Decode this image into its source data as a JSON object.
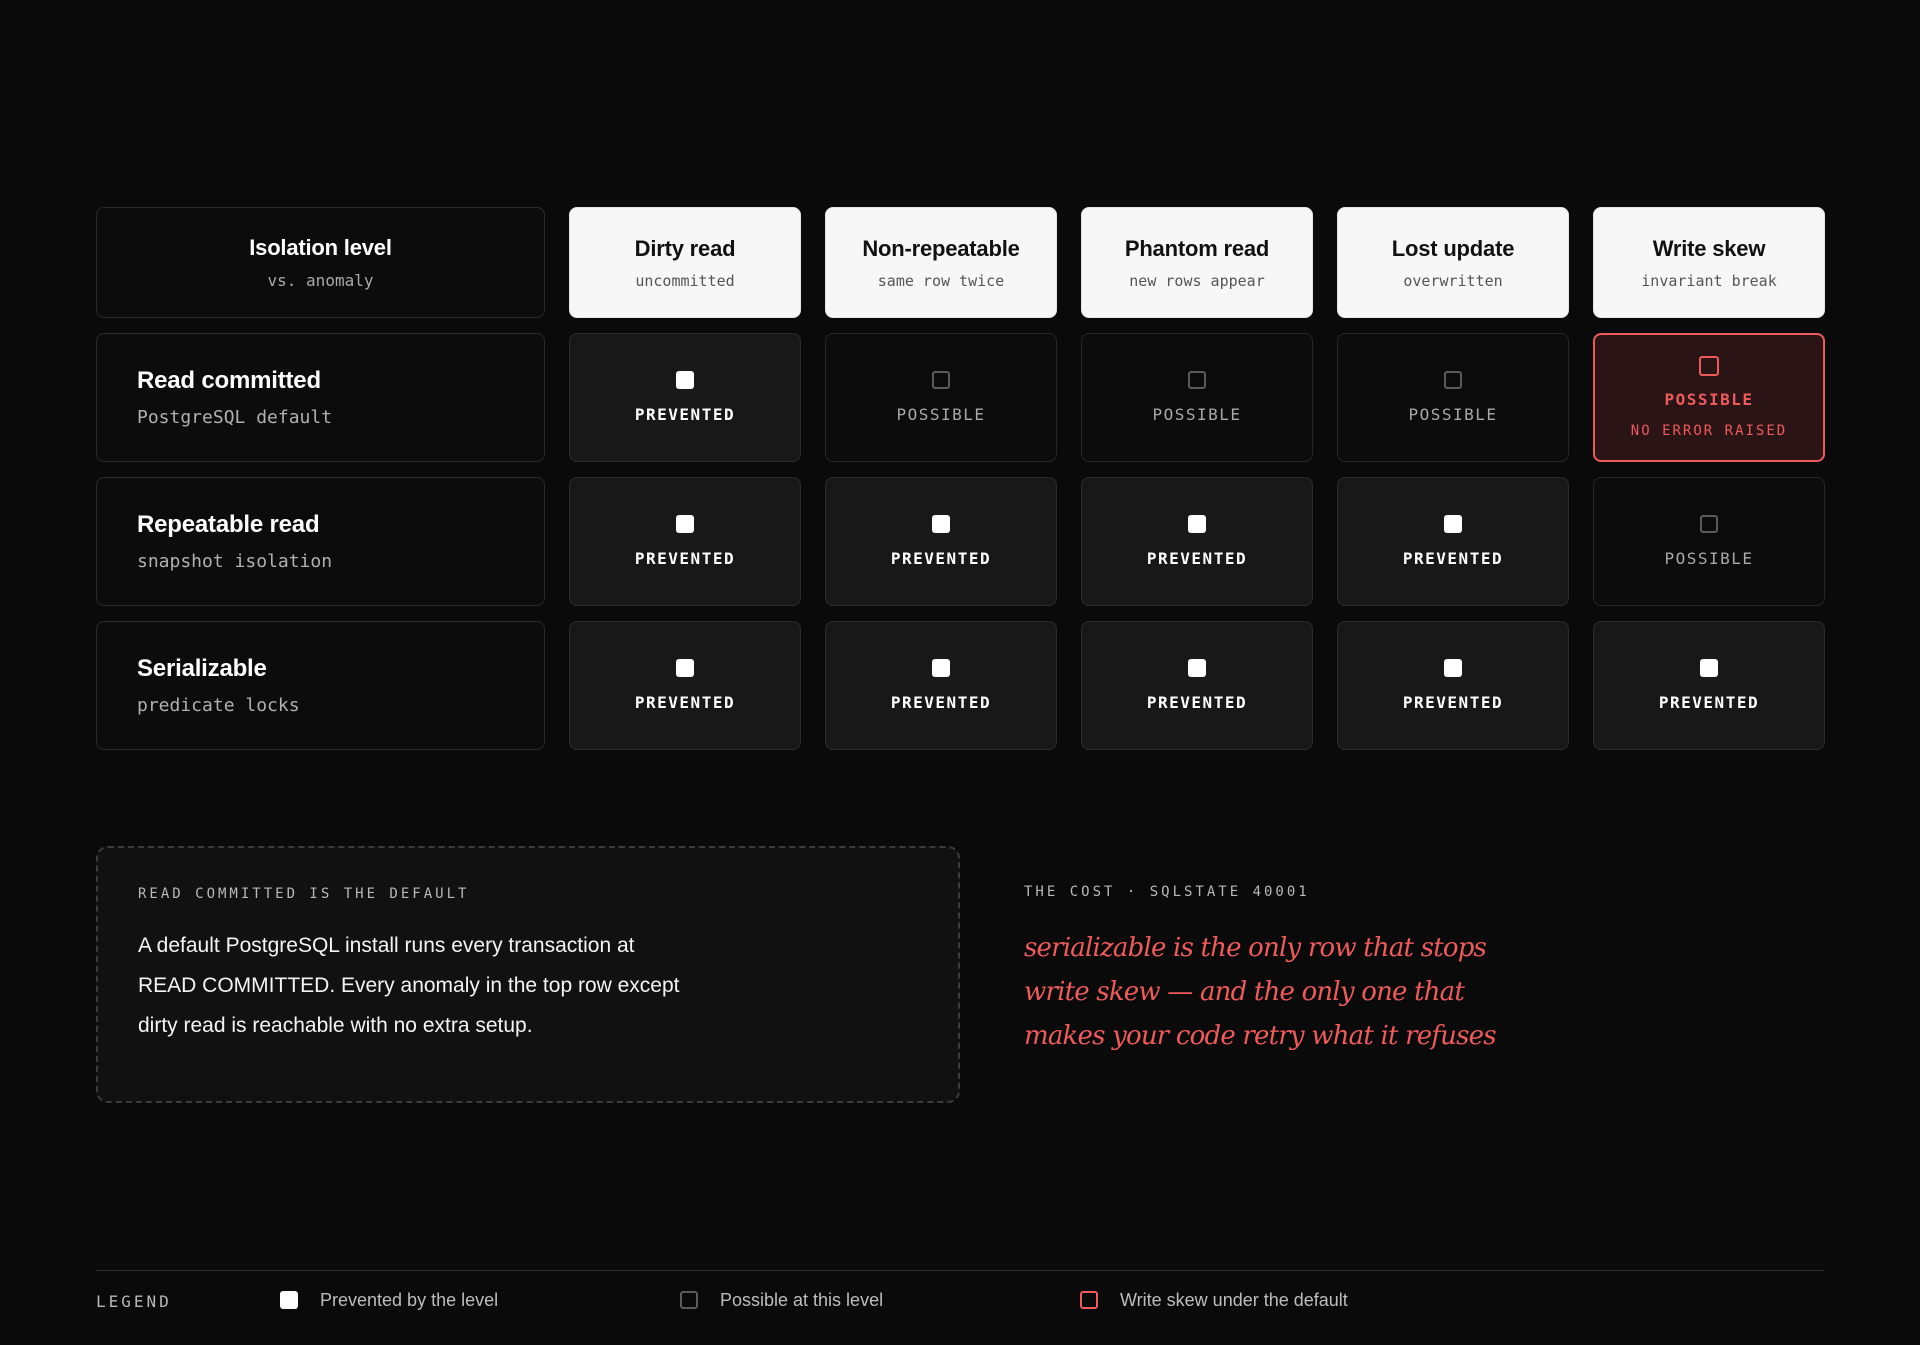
{
  "matrix": {
    "corner": {
      "title": "Isolation level",
      "subtitle": "vs. anomaly"
    },
    "columns": [
      {
        "title": "Dirty read",
        "subtitle": "uncommitted"
      },
      {
        "title": "Non-repeatable",
        "subtitle": "same row twice"
      },
      {
        "title": "Phantom read",
        "subtitle": "new rows appear"
      },
      {
        "title": "Lost update",
        "subtitle": "overwritten"
      },
      {
        "title": "Write skew",
        "subtitle": "invariant break"
      }
    ],
    "rows": [
      {
        "title": "Read committed",
        "subtitle": "PostgreSQL default",
        "cells": [
          {
            "state": "prevented",
            "label": "PREVENTED"
          },
          {
            "state": "possible",
            "label": "POSSIBLE"
          },
          {
            "state": "possible",
            "label": "POSSIBLE"
          },
          {
            "state": "possible",
            "label": "POSSIBLE"
          },
          {
            "state": "danger",
            "label": "POSSIBLE",
            "sub": "NO ERROR RAISED"
          }
        ]
      },
      {
        "title": "Repeatable read",
        "subtitle": "snapshot isolation",
        "cells": [
          {
            "state": "prevented",
            "label": "PREVENTED"
          },
          {
            "state": "prevented",
            "label": "PREVENTED"
          },
          {
            "state": "prevented",
            "label": "PREVENTED"
          },
          {
            "state": "prevented",
            "label": "PREVENTED"
          },
          {
            "state": "possible",
            "label": "POSSIBLE"
          }
        ]
      },
      {
        "title": "Serializable",
        "subtitle": "predicate locks",
        "cells": [
          {
            "state": "prevented",
            "label": "PREVENTED"
          },
          {
            "state": "prevented",
            "label": "PREVENTED"
          },
          {
            "state": "prevented",
            "label": "PREVENTED"
          },
          {
            "state": "prevented",
            "label": "PREVENTED"
          },
          {
            "state": "prevented",
            "label": "PREVENTED"
          }
        ]
      }
    ]
  },
  "note": {
    "kicker": "READ COMMITTED IS THE DEFAULT",
    "body": "A default PostgreSQL install runs every transaction at READ COMMITTED. Every anomaly in the top row except dirty read is reachable with no extra setup."
  },
  "cost": {
    "kicker": "THE COST · SQLSTATE 40001",
    "quote": "serializable is the only row that stops write skew — and the only one that makes your code retry what it refuses"
  },
  "legend": {
    "label": "LEGEND",
    "items": [
      {
        "text": "Prevented by the level",
        "swatch": "prevented"
      },
      {
        "text": "Possible at this level",
        "swatch": "possible"
      },
      {
        "text": "Write skew under the default",
        "swatch": "danger"
      }
    ]
  },
  "colors": {
    "background": "#0a0a0a",
    "accent": "#ef5a5a",
    "prevented_fill": "#ffffff",
    "possible_border": "#5a5a5a"
  }
}
